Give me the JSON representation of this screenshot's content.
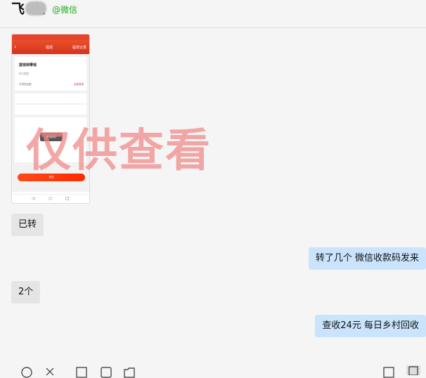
{
  "header": {
    "contact_name": "飞 鱼",
    "source_label": "@微信"
  },
  "image_message": {
    "nav_title": "提现",
    "nav_right": "提现记录",
    "card_heading": "提现到零钱",
    "card_subtitle": "单日限额",
    "row_left": "可提现金额",
    "row_right": "全部提现",
    "toast_text": "提现成功",
    "button_label": "提现"
  },
  "watermark": {
    "text": "仅供查看",
    "color": "#f08a8a"
  },
  "messages": [
    {
      "direction": "incoming",
      "text": "已转"
    },
    {
      "direction": "outgoing",
      "text": "转了几个  微信收款码发来"
    },
    {
      "direction": "incoming",
      "text": "2个"
    },
    {
      "direction": "outgoing",
      "text": "查收24元 每日乡村回收"
    }
  ],
  "colors": {
    "incoming_bubble": "#e5e5e5",
    "outgoing_bubble": "#c9e4fc",
    "source": "#1aad19"
  },
  "toolbar": {
    "icons": [
      "smiley-icon",
      "scissors-icon",
      "screenshot-icon",
      "chat-history-icon",
      "folder-icon",
      "add-icon",
      "sidebar-icon"
    ]
  }
}
